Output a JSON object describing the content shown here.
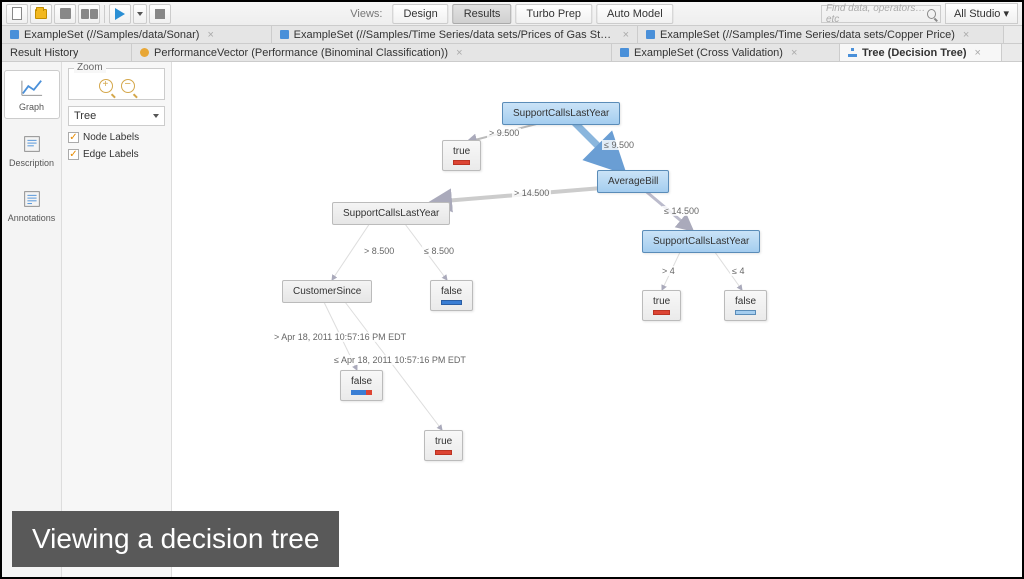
{
  "toolbar": {
    "views_label": "Views:",
    "views": [
      "Design",
      "Results",
      "Turbo Prep",
      "Auto Model"
    ],
    "active_view": "Results",
    "search_placeholder": "Find data, operators…etc",
    "studio_label": "All Studio ▾"
  },
  "tabs_row1": [
    {
      "label": "ExampleSet (//Samples/data/Sonar)",
      "icon": "data"
    },
    {
      "label": "ExampleSet (//Samples/Time Series/data sets/Prices of Gas Station)",
      "icon": "data"
    },
    {
      "label": "ExampleSet (//Samples/Time Series/data sets/Copper Price)",
      "icon": "data"
    }
  ],
  "tabs_row2": [
    {
      "label": "Result History",
      "icon": "none"
    },
    {
      "label": "PerformanceVector (Performance (Binominal Classification))",
      "icon": "perf"
    },
    {
      "label": "ExampleSet (Cross Validation)",
      "icon": "data"
    },
    {
      "label": "Tree (Decision Tree)",
      "icon": "tree",
      "active": true
    }
  ],
  "sidebar": [
    {
      "label": "Graph",
      "active": true
    },
    {
      "label": "Description"
    },
    {
      "label": "Annotations"
    }
  ],
  "controls": {
    "zoom_title": "Zoom",
    "dropdown": "Tree",
    "checkbox1": "Node Labels",
    "checkbox2": "Edge Labels"
  },
  "tree": {
    "nodes": {
      "root": "SupportCallsLastYear",
      "avg": "AverageBill",
      "sup2": "SupportCallsLastYear",
      "sup3": "SupportCallsLastYear",
      "cust": "CustomerSince"
    },
    "leaves": {
      "true1": "true",
      "false1": "false",
      "true2": "true",
      "false2": "false",
      "false3": "false",
      "true3": "true"
    },
    "edges": {
      "e1": "> 9.500",
      "e2": "≤ 9.500",
      "e3": "> 14.500",
      "e4": "≤ 14.500",
      "e5": "> 8.500",
      "e6": "≤ 8.500",
      "e7": "> 4",
      "e8": "≤ 4",
      "e9": "> Apr 18, 2011 10:57:16 PM EDT",
      "e10": "≤ Apr 18, 2011 10:57:16 PM EDT"
    }
  },
  "caption": "Viewing a decision tree"
}
